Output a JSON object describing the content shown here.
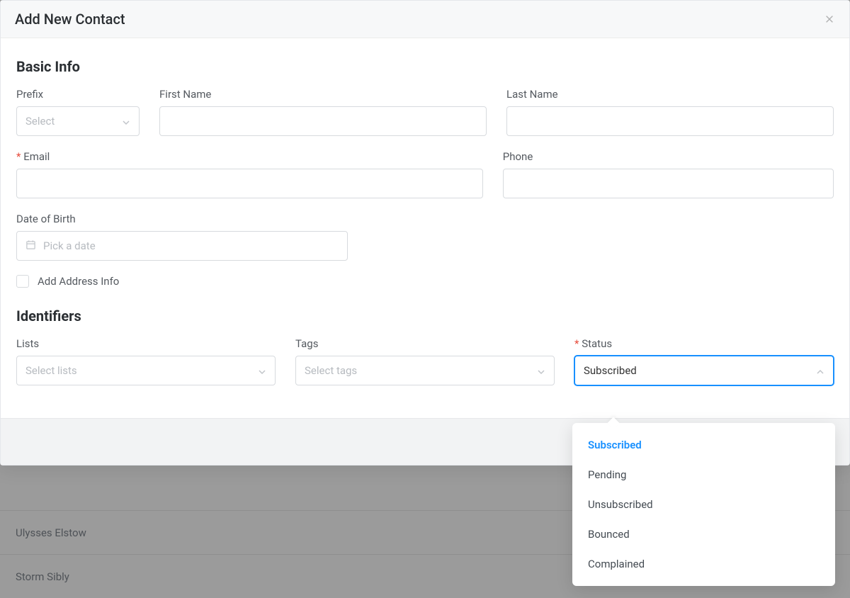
{
  "modal": {
    "title": "Add New Contact"
  },
  "basic": {
    "heading": "Basic Info",
    "prefix": {
      "label": "Prefix",
      "placeholder": "Select"
    },
    "first_name": {
      "label": "First Name"
    },
    "last_name": {
      "label": "Last Name"
    },
    "email": {
      "label": "Email"
    },
    "phone": {
      "label": "Phone"
    },
    "dob": {
      "label": "Date of Birth",
      "placeholder": "Pick a date"
    },
    "add_address": {
      "label": "Add Address Info"
    }
  },
  "identifiers": {
    "heading": "Identifiers",
    "lists": {
      "label": "Lists",
      "placeholder": "Select lists"
    },
    "tags": {
      "label": "Tags",
      "placeholder": "Select tags"
    },
    "status": {
      "label": "Status",
      "value": "Subscribed",
      "options": [
        "Subscribed",
        "Pending",
        "Unsubscribed",
        "Bounced",
        "Complained"
      ]
    }
  },
  "background_rows": [
    "Ulysses Elstow",
    "Storm Sibly"
  ]
}
